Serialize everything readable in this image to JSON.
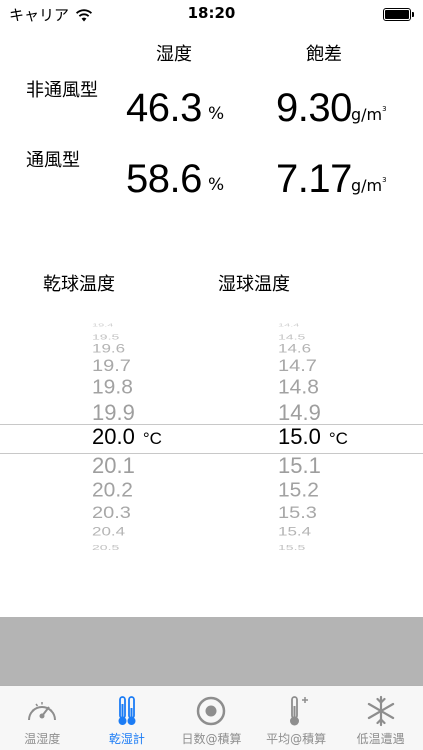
{
  "status_bar": {
    "carrier": "キャリア",
    "time": "18:20"
  },
  "results": {
    "headers": {
      "humidity": "湿度",
      "deficit": "飽差"
    },
    "rows": [
      {
        "label": "非通風型",
        "humidity": "46.3",
        "humidity_unit": "%",
        "deficit": "9.30",
        "deficit_unit": "g/m",
        "deficit_sup": "3"
      },
      {
        "label": "通風型",
        "humidity": "58.6",
        "humidity_unit": "%",
        "deficit": "7.17",
        "deficit_unit": "g/m",
        "deficit_sup": "3"
      }
    ]
  },
  "pickers": {
    "dry": {
      "title": "乾球温度",
      "values": [
        "19.4",
        "19.5",
        "19.6",
        "19.7",
        "19.8",
        "19.9",
        "20.0",
        "20.1",
        "20.2",
        "20.3",
        "20.4",
        "20.5"
      ],
      "selected": "20.0",
      "unit": "°C"
    },
    "wet": {
      "title": "湿球温度",
      "values": [
        "14.4",
        "14.5",
        "14.6",
        "14.7",
        "14.8",
        "14.9",
        "15.0",
        "15.1",
        "15.2",
        "15.3",
        "15.4",
        "15.5"
      ],
      "selected": "15.0",
      "unit": "°C"
    }
  },
  "tabs": [
    {
      "label": "温湿度",
      "icon": "gauge-icon",
      "active": false
    },
    {
      "label": "乾湿計",
      "icon": "thermometer-pair-icon",
      "active": true
    },
    {
      "label": "日数@積算",
      "icon": "target-icon",
      "active": false
    },
    {
      "label": "平均@積算",
      "icon": "thermometer-plus-icon",
      "active": false
    },
    {
      "label": "低温遭遇",
      "icon": "snowflake-icon",
      "active": false
    }
  ],
  "colors": {
    "active_tab": "#1b7cf5",
    "inactive_tab": "#8e8e8e",
    "band": "#b4b4b4"
  }
}
